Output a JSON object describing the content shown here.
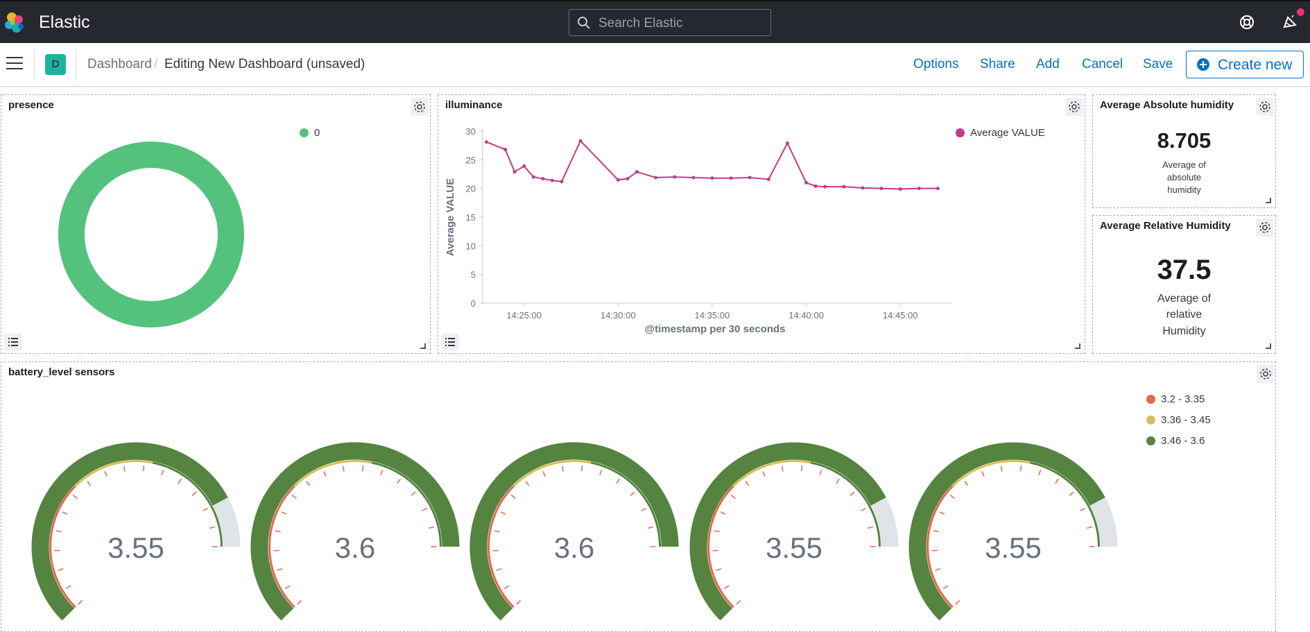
{
  "header": {
    "app_title": "Elastic",
    "search_placeholder": "Search Elastic",
    "icons": [
      "elastic-logo",
      "search-icon",
      "help-icon",
      "newsfeed-icon"
    ]
  },
  "breadcrumb": {
    "space_initial": "D",
    "parent": "Dashboard",
    "separator": "/",
    "current": "Editing New Dashboard (unsaved)"
  },
  "actions": {
    "options": "Options",
    "share": "Share",
    "add": "Add",
    "cancel": "Cancel",
    "save": "Save",
    "create_new": "Create new"
  },
  "panels": {
    "presence": {
      "title": "presence",
      "legend": [
        {
          "label": "0",
          "color": "#54c27d"
        }
      ]
    },
    "illuminance": {
      "title": "illuminance",
      "legend_label": "Average VALUE",
      "series_color": "#c33a8a"
    },
    "abs_humidity": {
      "title": "Average Absolute humidity",
      "value": "8.705",
      "label_lines": [
        "Average of",
        "absolute",
        "humidity"
      ]
    },
    "rel_humidity": {
      "title": "Average Relative Humidity",
      "value": "37.5",
      "label_lines": [
        "Average of",
        "relative",
        "Humidity"
      ]
    },
    "battery": {
      "title": "battery_level sensors",
      "legend": [
        {
          "label": "3.2 - 3.35",
          "color": "#e7664c"
        },
        {
          "label": "3.36 - 3.45",
          "color": "#d6bf57"
        },
        {
          "label": "3.46 - 3.6",
          "color": "#54843f"
        }
      ],
      "gauges": [
        {
          "value": 3.55,
          "label": "3.55"
        },
        {
          "value": 3.6,
          "label": "3.6"
        },
        {
          "value": 3.6,
          "label": "3.6"
        },
        {
          "value": 3.55,
          "label": "3.55"
        },
        {
          "value": 3.55,
          "label": "3.55"
        }
      ],
      "gauge_range": [
        3.2,
        3.6
      ]
    }
  },
  "chart_data": [
    {
      "type": "pie",
      "title": "presence",
      "labels": [
        "0"
      ],
      "values": [
        1
      ],
      "donut": true
    },
    {
      "type": "line",
      "title": "illuminance",
      "xlabel": "@timestamp per 30 seconds",
      "ylabel": "Average VALUE",
      "ylim": [
        0,
        30
      ],
      "yticks": [
        "0",
        "5",
        "10",
        "15",
        "20",
        "25",
        "30"
      ],
      "xticks": [
        "14:25:00",
        "14:30:00",
        "14:35:00",
        "14:40:00",
        "14:45:00"
      ],
      "grid": false,
      "legend_position": "top-right",
      "series": [
        {
          "name": "Average VALUE",
          "x": [
            "14:23:00",
            "14:24:00",
            "14:24:30",
            "14:25:00",
            "14:25:30",
            "14:26:00",
            "14:26:30",
            "14:27:00",
            "14:28:00",
            "14:30:00",
            "14:30:30",
            "14:31:00",
            "14:32:00",
            "14:33:00",
            "14:34:00",
            "14:35:00",
            "14:36:00",
            "14:37:00",
            "14:38:00",
            "14:39:00",
            "14:40:00",
            "14:40:30",
            "14:41:00",
            "14:42:00",
            "14:43:00",
            "14:44:00",
            "14:45:00",
            "14:46:00",
            "14:47:00"
          ],
          "y": [
            28.1,
            26.8,
            22.9,
            23.9,
            22.0,
            21.7,
            21.4,
            21.2,
            28.3,
            21.5,
            21.7,
            22.9,
            21.9,
            22.0,
            21.9,
            21.8,
            21.8,
            21.9,
            21.6,
            27.9,
            21.0,
            20.4,
            20.3,
            20.3,
            20.1,
            20.0,
            19.9,
            20.0,
            20.0
          ]
        }
      ]
    },
    {
      "type": "gauge",
      "title": "battery_level sensors",
      "range": [
        3.2,
        3.6
      ],
      "values": [
        3.55,
        3.6,
        3.6,
        3.55,
        3.55
      ]
    }
  ]
}
